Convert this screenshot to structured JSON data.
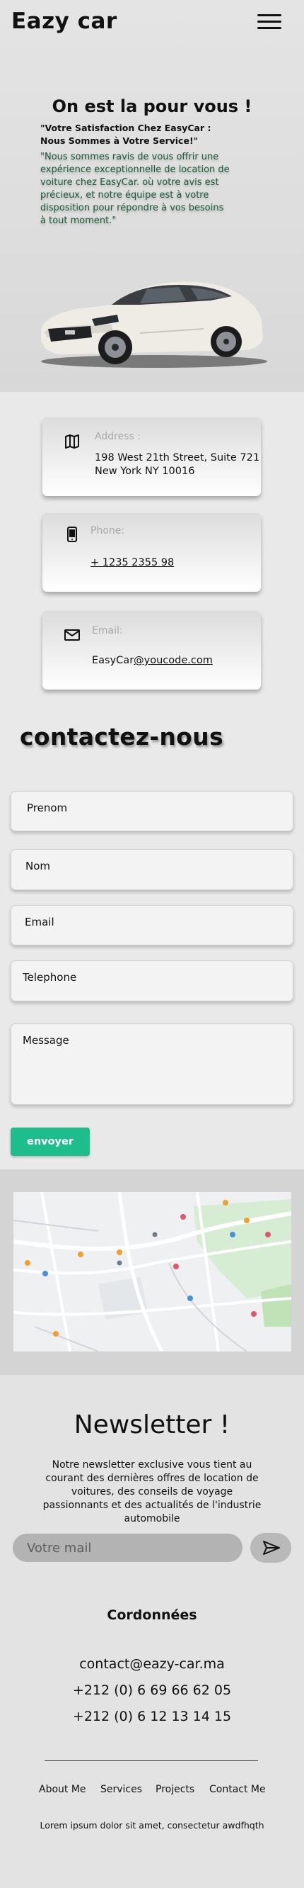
{
  "header": {
    "brand": "Eazy car",
    "menu_icon": "hamburger-menu-icon"
  },
  "hero": {
    "title": "On est la pour vous !",
    "subtitle": "\"Votre Satisfaction Chez EasyCar : Nous Sommes à Votre Service!\"",
    "quote": "\"Nous sommes ravis de vous offrir une expérience exceptionnelle de location de voiture chez EasyCar. où votre avis est précieux, et notre équipe est à votre disposition pour répondre à vos besoins à tout moment.\"",
    "image": "white-sports-car"
  },
  "info_cards": {
    "address": {
      "icon": "map-icon",
      "label": "Address :",
      "value_line1": "198 West 21th Street, Suite 721",
      "value_line2": "New York NY 10016"
    },
    "phone": {
      "icon": "phone-icon",
      "label": "Phone:",
      "value": "+ 1235 2355 98"
    },
    "email": {
      "icon": "envelope-icon",
      "label": "Email:",
      "value_prefix": "EasyCar",
      "value_link": "@youcode.com"
    }
  },
  "contact": {
    "title": "contactez-nous",
    "fields": {
      "prenom": "Prenom",
      "nom": "Nom",
      "email": "Email",
      "telephone": "Telephone",
      "message": "Message"
    },
    "submit_label": "envoyer"
  },
  "map": {
    "type": "street-map"
  },
  "newsletter": {
    "title": "Newsletter !",
    "text": "Notre newsletter exclusive vous tient au courant des dernières offres de location de voitures, des conseils de voyage passionnants et des actualités de l'industrie automobile",
    "input_placeholder": "Votre mail",
    "send_icon": "paper-plane-icon"
  },
  "coordinates": {
    "title": "Cordonnées",
    "email": "contact@eazy-car.ma",
    "phone1": "+212 (0) 6 69 66 62 05",
    "phone2": "+212 (0) 6 12 13 14 15"
  },
  "footer_nav": {
    "about": "About Me",
    "services": "Services",
    "projects": "Projects",
    "contact": "Contact Me"
  },
  "footer_text": "Lorem ipsum dolor sit amet, consectetur awdfhqth",
  "colors": {
    "accent": "#1ebd8c",
    "quote_green": "#1a5c3a"
  }
}
